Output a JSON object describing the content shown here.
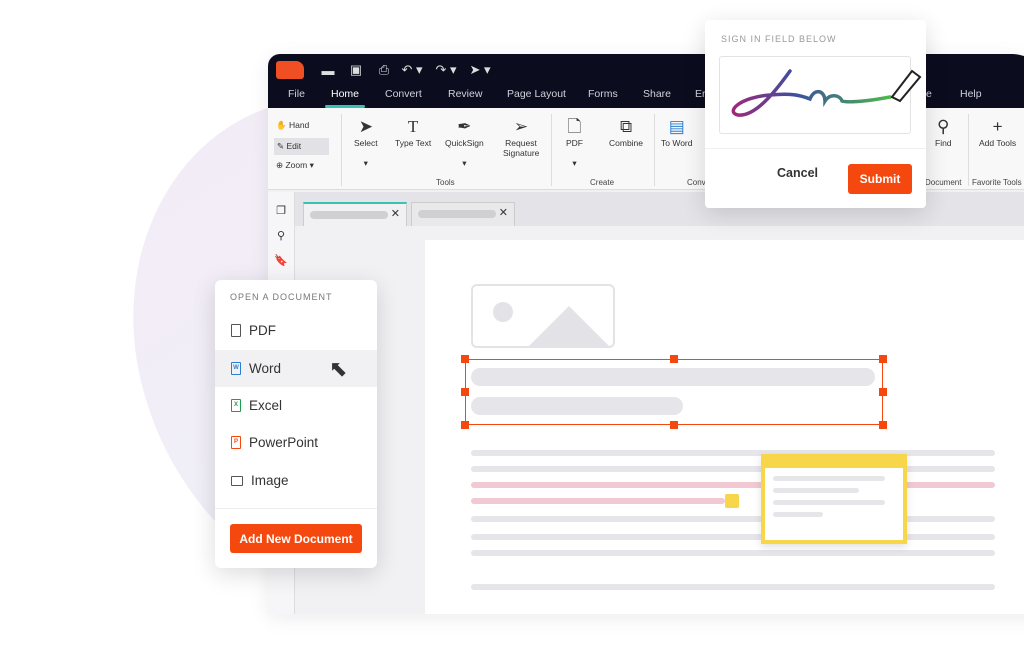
{
  "colors": {
    "accent": "#f5480f",
    "dark": "#0b0d1f",
    "tab_indicator": "#37c2b4",
    "note": "#f7d64a"
  },
  "menu": [
    "File",
    "Home",
    "Convert",
    "Review",
    "Page Layout",
    "Forms",
    "Share",
    "Er",
    "e",
    "Help"
  ],
  "ribbon": {
    "small": [
      "Hand",
      "Edit",
      "Zoom"
    ],
    "tools": [
      "Select",
      "Type Text",
      "QuickSign",
      "Request Signature",
      "PDF",
      "Combine",
      "To Word",
      "Find",
      "Add Tools"
    ],
    "groups": [
      "Tools",
      "Create",
      "Conv",
      "Document",
      "Favorite Tools"
    ]
  },
  "open_document": {
    "heading": "OPEN A DOCUMENT",
    "items": [
      "PDF",
      "Word",
      "Excel",
      "PowerPoint",
      "Image"
    ],
    "button": "Add New Document"
  },
  "sign": {
    "heading": "SIGN IN FIELD BELOW",
    "cancel": "Cancel",
    "submit": "Submit"
  }
}
